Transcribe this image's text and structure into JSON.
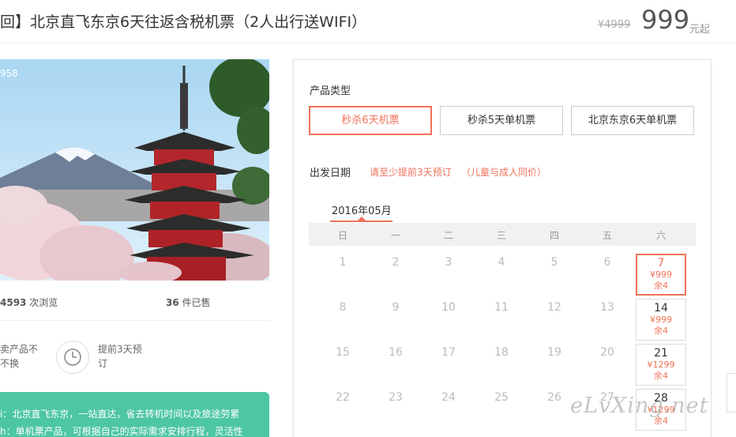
{
  "header": {
    "title": "回】北京直飞东京6天往返含税机票（2人出行送WIFI）",
    "original_price": "¥4999",
    "price": "999",
    "price_unit": "元起"
  },
  "gallery": {
    "photo_id": "958"
  },
  "stats": {
    "views": "4593",
    "views_label": "次浏览",
    "sold": "36",
    "sold_label": "件已售"
  },
  "features": [
    {
      "text1": "卖产品不",
      "text2": "不换"
    },
    {
      "text1": "提前3天预",
      "text2": "订"
    }
  ],
  "highlights": [
    "i：北京直飞东京，一站直达，省去转机时间以及旅途劳累",
    "h：单机票产品，可根据自己的实际需求安排行程，灵活性"
  ],
  "booking": {
    "type_label": "产品类型",
    "types": [
      "秒杀6天机票",
      "秒杀5天单机票",
      "北京东京6天单机票"
    ],
    "date_label": "出发日期",
    "hint_advance": "请至少提前3天预订",
    "hint_child": "（儿童与成人同价）",
    "month": "2016年05月",
    "weekdays": [
      "日",
      "一",
      "二",
      "三",
      "四",
      "五",
      "六"
    ],
    "plain_days": [
      [
        "1",
        "2",
        "3",
        "4",
        "5",
        "6"
      ],
      [
        "8",
        "9",
        "10",
        "11",
        "12",
        "13"
      ],
      [
        "15",
        "16",
        "17",
        "18",
        "19",
        "20"
      ],
      [
        "22",
        "23",
        "24",
        "25",
        "26",
        "27"
      ]
    ],
    "available": [
      {
        "day": "7",
        "price": "¥999",
        "remain": "余4"
      },
      {
        "day": "14",
        "price": "¥999",
        "remain": "余4"
      },
      {
        "day": "21",
        "price": "¥1299",
        "remain": "余4"
      },
      {
        "day": "28",
        "price": "¥1299",
        "remain": "余4"
      }
    ]
  },
  "watermark": "eLvXing.net",
  "colors": {
    "accent": "#ef7259",
    "green": "#4dc6a4"
  }
}
